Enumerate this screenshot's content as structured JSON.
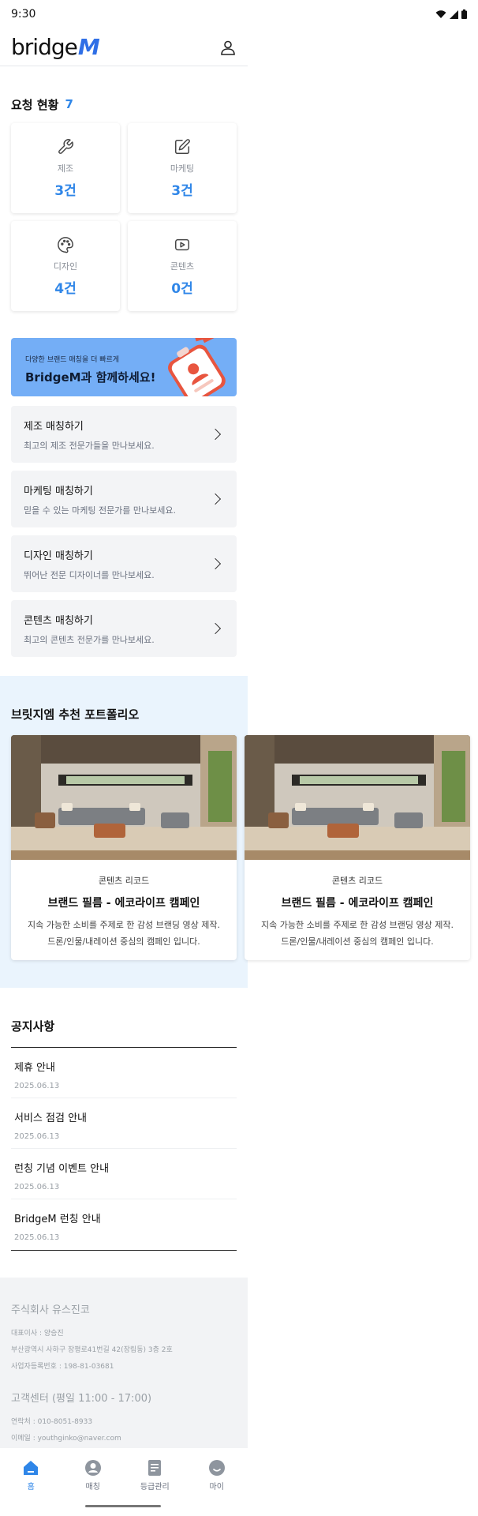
{
  "status_bar": {
    "time": "9:30"
  },
  "header": {
    "logo_text": "bridge",
    "logo_accent": "M"
  },
  "request_status": {
    "title": "요청 현황",
    "count": "7",
    "cards": [
      {
        "icon": "wrench-icon",
        "label": "제조",
        "value": "3건"
      },
      {
        "icon": "edit-icon",
        "label": "마케팅",
        "value": "3건"
      },
      {
        "icon": "palette-icon",
        "label": "디자인",
        "value": "4건"
      },
      {
        "icon": "play-icon",
        "label": "콘텐츠",
        "value": "0건"
      }
    ]
  },
  "banner": {
    "small": "다양한 브랜드 매칭을 더 빠르게",
    "big": "BridgeM과 함께하세요!"
  },
  "match_items": [
    {
      "title": "제조 매칭하기",
      "desc": "최고의 제조 전문가들을 만나보세요."
    },
    {
      "title": "마케팅 매칭하기",
      "desc": "믿을 수 있는 마케팅 전문가를 만나보세요."
    },
    {
      "title": "디자인 매칭하기",
      "desc": "뛰어난 전문 디자이너를 만나보세요."
    },
    {
      "title": "콘텐츠 매칭하기",
      "desc": "최고의 콘텐츠 전문가를 만나보세요."
    }
  ],
  "portfolio": {
    "title": "브릿지엠 추천 포트폴리오",
    "cards": [
      {
        "category": "콘텐츠 리코드",
        "title": "브랜드 필름 - 에코라이프 캠페인",
        "desc1": "지속 가능한 소비를 주제로 한 감성 브랜딩 영상 제작.",
        "desc2": "드론/인물/내레이션 중심의 캠페인 입니다."
      },
      {
        "category": "콘텐츠 리코드",
        "title": "브랜드 필름 - 에코라이프 캠페인",
        "desc1": "지속 가능한 소비를 주제로 한 감성 브랜딩 영상 제작.",
        "desc2": "드론/인물/내레이션 중심의 캠페인 입니다."
      }
    ]
  },
  "notice": {
    "title": "공지사항",
    "items": [
      {
        "title": "제휴 안내",
        "date": "2025.06.13"
      },
      {
        "title": "서비스 점검 안내",
        "date": "2025.06.13"
      },
      {
        "title": "런칭 기념 이벤트 안내",
        "date": "2025.06.13"
      },
      {
        "title": "BridgeM 런칭 안내",
        "date": "2025.06.13"
      }
    ]
  },
  "footer": {
    "company": "주식회사 유스진코",
    "ceo": "대표이사 : 양승진",
    "address": "부산광역시 사하구 장평로41번길 42(장림동) 3층 2호",
    "biz_no": "사업자등록번호 : 198-81-03681",
    "cs_title": "고객센터 (평일 11:00 - 17:00)",
    "phone": "연락처 : 010-8051-8933",
    "email": "이메일 : youthginko@naver.com"
  },
  "bottom_nav": [
    {
      "label": "홈",
      "icon": "home-icon",
      "active": true
    },
    {
      "label": "매칭",
      "icon": "user-icon",
      "active": false
    },
    {
      "label": "등급관리",
      "icon": "document-icon",
      "active": false
    },
    {
      "label": "마이",
      "icon": "smile-icon",
      "active": false
    }
  ],
  "colors": {
    "accent": "#2f86e8",
    "banner": "#74aef6",
    "portfolio_bg": "#eaf4fd"
  }
}
